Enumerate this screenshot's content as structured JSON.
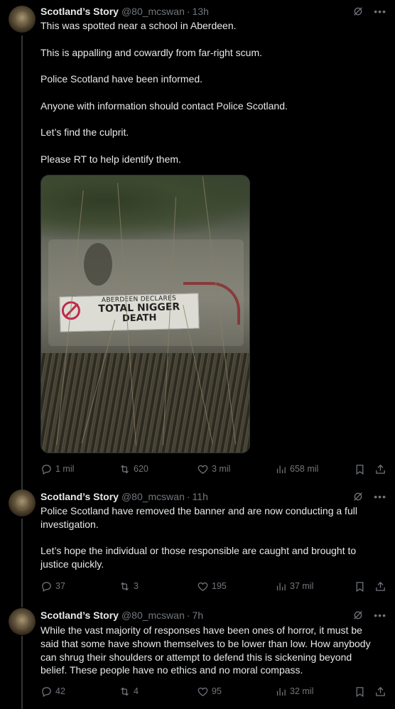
{
  "tweets": [
    {
      "name": "Scotland’s Story",
      "handle": "@80_mcswan",
      "time": "13h",
      "lines": [
        "This was spotted near a school in Aberdeen.",
        "This is appalling and cowardly from far-right scum.",
        "Police Scotland have been informed.",
        "Anyone with information should contact Police Scotland.",
        "Let’s find the culprit.",
        "Please RT to help identify them."
      ],
      "image_banner": [
        "ABERDEEN DECLARES",
        "TOTAL NIGGER",
        "DEATH"
      ],
      "replies": "1 mil",
      "retweets": "620",
      "likes": "3 mil",
      "views": "658 mil"
    },
    {
      "name": "Scotland’s Story",
      "handle": "@80_mcswan",
      "time": "11h",
      "para1": "Police Scotland have removed the banner and are now conducting a full investigation.",
      "para2": "Let’s hope the individual or those responsible are caught and brought to justice quickly.",
      "replies": "37",
      "retweets": "3",
      "likes": "195",
      "views": "37 mil"
    },
    {
      "name": "Scotland’s Story",
      "handle": "@80_mcswan",
      "time": "7h",
      "para1": "While the vast majority of responses have been ones of horror, it must be said that some have shown themselves to be lower than low. How anybody can shrug their shoulders or attempt to defend this is sickening beyond belief. These people have no ethics and no moral compass.",
      "replies": "42",
      "retweets": "4",
      "likes": "95",
      "views": "32 mil"
    }
  ],
  "separator": "·",
  "icons": {
    "reply": "reply-icon",
    "retweet": "retweet-icon",
    "like": "heart-icon",
    "views": "views-icon",
    "bookmark": "bookmark-icon",
    "share": "share-icon",
    "grok": "grok-icon",
    "more": "more-icon"
  },
  "colors": {
    "background": "#000000",
    "text": "#e7e9ea",
    "muted": "#71767b",
    "thread_line": "#333639"
  }
}
